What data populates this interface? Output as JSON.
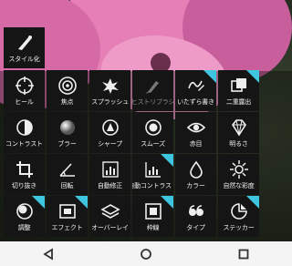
{
  "tools": {
    "stylize": "スタイル化",
    "heal": "ヒール",
    "focus": "焦点",
    "splash": "スプラッシュ",
    "histogram": "ヒストリブラシ",
    "doodle": "いたずら書き",
    "double_exposure": "二重露出",
    "contrast": "コントラスト",
    "blur": "ブラー",
    "sharpen": "シャープ",
    "smooth": "スムーズ",
    "red_eye": "赤目",
    "brightness": "明るさ",
    "crop": "切り抜き",
    "rotate": "回転",
    "auto_fix": "自動修正",
    "auto_contrast": "自動コントラスト",
    "color": "カラー",
    "natural_saturation": "自然な彩度",
    "adjust": "調整",
    "effects": "エフェクト",
    "overlay": "オーバーレイ",
    "frames": "枠線",
    "type": "タイプ",
    "stickers": "ステッカー"
  },
  "accent_color": "#3ec6e0",
  "icons": {
    "stylize": "brush-icon",
    "heal": "crosshair-icon",
    "focus": "target-icon",
    "splash": "splash-icon",
    "histogram": "brush-icon",
    "doodle": "doodle-icon",
    "double_exposure": "layers-icon",
    "contrast": "half-circle-icon",
    "blur": "sphere-icon",
    "sharpen": "triangle-dot-icon",
    "smooth": "smooth-icon",
    "red_eye": "eye-icon",
    "brightness": "diamond-icon",
    "crop": "crop-icon",
    "rotate": "rotate-icon",
    "auto_fix": "bar-chart-icon",
    "auto_contrast": "bar-chart-icon",
    "color": "drop-icon",
    "natural_saturation": "sun-icon",
    "adjust": "adjust-icon",
    "effects": "film-icon",
    "overlay": "layers-icon",
    "frames": "frame-icon",
    "type": "quote-icon",
    "stickers": "sticker-icon"
  }
}
